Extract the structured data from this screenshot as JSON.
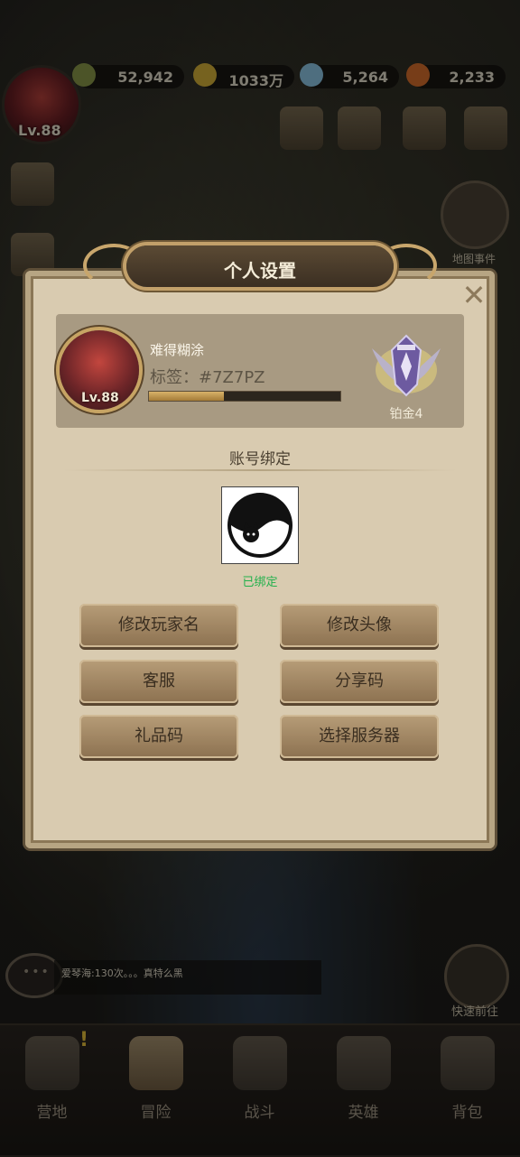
{
  "resources": {
    "power": "52,942",
    "gold": "1033万",
    "diamonds": "5,264",
    "gems": "2,233"
  },
  "player_top": {
    "level": "Lv.88"
  },
  "side": {
    "map_event_label": "地图事件",
    "quick_go_label": "快速前往"
  },
  "modal": {
    "title": "个人设置",
    "close": "✕",
    "profile": {
      "name": "难得糊涂",
      "tag": "标签：#7Z7PZ",
      "level": "Lv.88",
      "xp_progress": 0.39,
      "rank": "铂金4"
    },
    "binding": {
      "title": "账号绑定",
      "status": "已绑定"
    },
    "buttons": {
      "rename": "修改玩家名",
      "change_avatar": "修改头像",
      "support": "客服",
      "share_code": "分享码",
      "gift_code": "礼品码",
      "select_server": "选择服务器"
    }
  },
  "chat": {
    "message": "爱琴海:130次。。。真特么黑"
  },
  "nav": {
    "tabs": [
      {
        "label": "营地"
      },
      {
        "label": "冒险"
      },
      {
        "label": "战斗"
      },
      {
        "label": "英雄"
      },
      {
        "label": "背包"
      }
    ]
  },
  "colors": {
    "bound_status": "#22b14c",
    "gold_accent": "#c8a66c"
  }
}
